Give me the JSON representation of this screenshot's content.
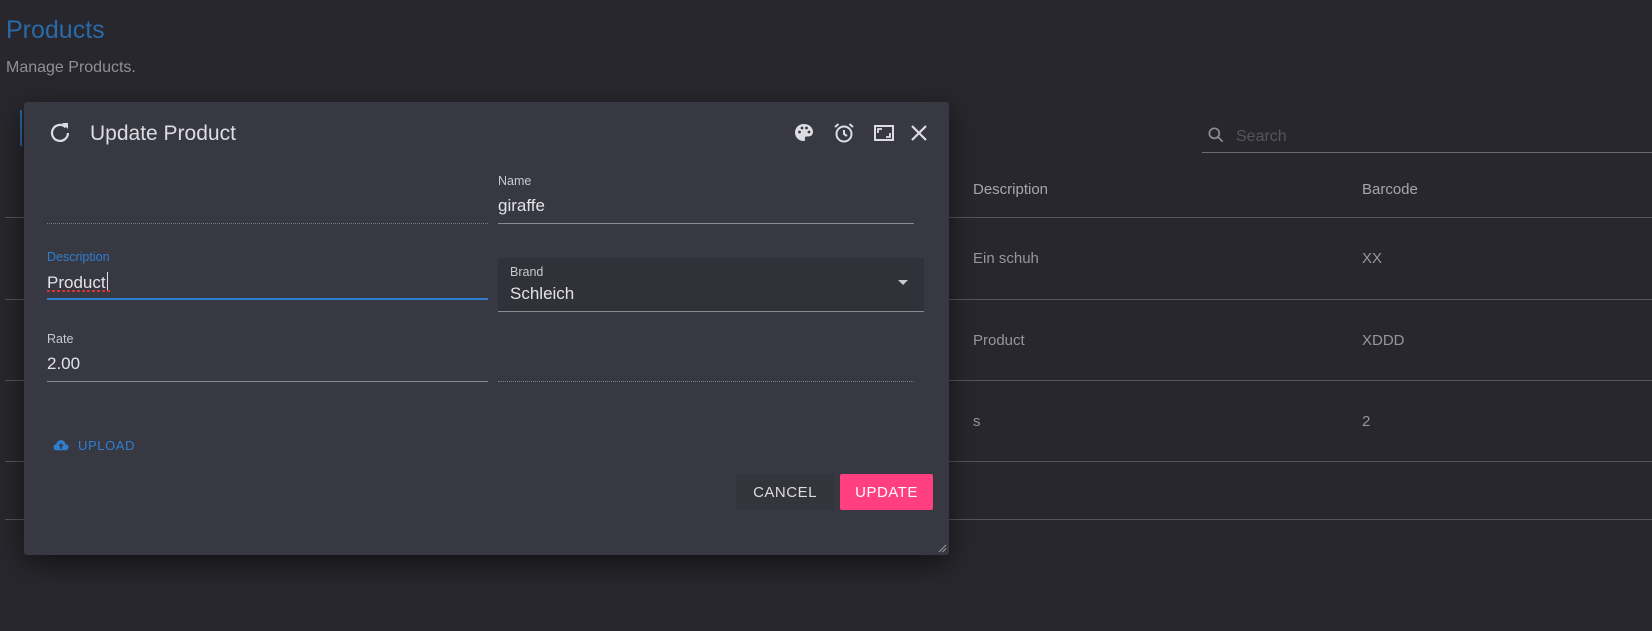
{
  "page": {
    "title": "Products",
    "subtitle": "Manage Products."
  },
  "search": {
    "placeholder": "Search",
    "value": ""
  },
  "table": {
    "headers": [
      "Description",
      "Barcode"
    ],
    "rows": [
      {
        "description": "Ein schuh",
        "barcode": "XX"
      },
      {
        "description": "Product",
        "barcode": "XDDD"
      },
      {
        "description": "s",
        "barcode": "2"
      }
    ]
  },
  "dialog": {
    "title": "Update Product",
    "icons": {
      "refresh": "refresh-icon",
      "palette": "palette-icon",
      "alarm": "alarm-clock-icon",
      "fullscreen": "fullscreen-icon",
      "close": "close-icon"
    },
    "fields": {
      "name": {
        "label": "Name",
        "value": "giraffe"
      },
      "description": {
        "label": "Description",
        "value": "Product"
      },
      "brand": {
        "label": "Brand",
        "value": "Schleich"
      },
      "rate": {
        "label": "Rate",
        "value": "2.00"
      }
    },
    "upload_label": "UPLOAD",
    "cancel_label": "CANCEL",
    "update_label": "UPDATE"
  },
  "colors": {
    "background": "#28272d",
    "dialog": "#383842",
    "primary": "#2f7fd0",
    "accent": "#ff3f80"
  }
}
